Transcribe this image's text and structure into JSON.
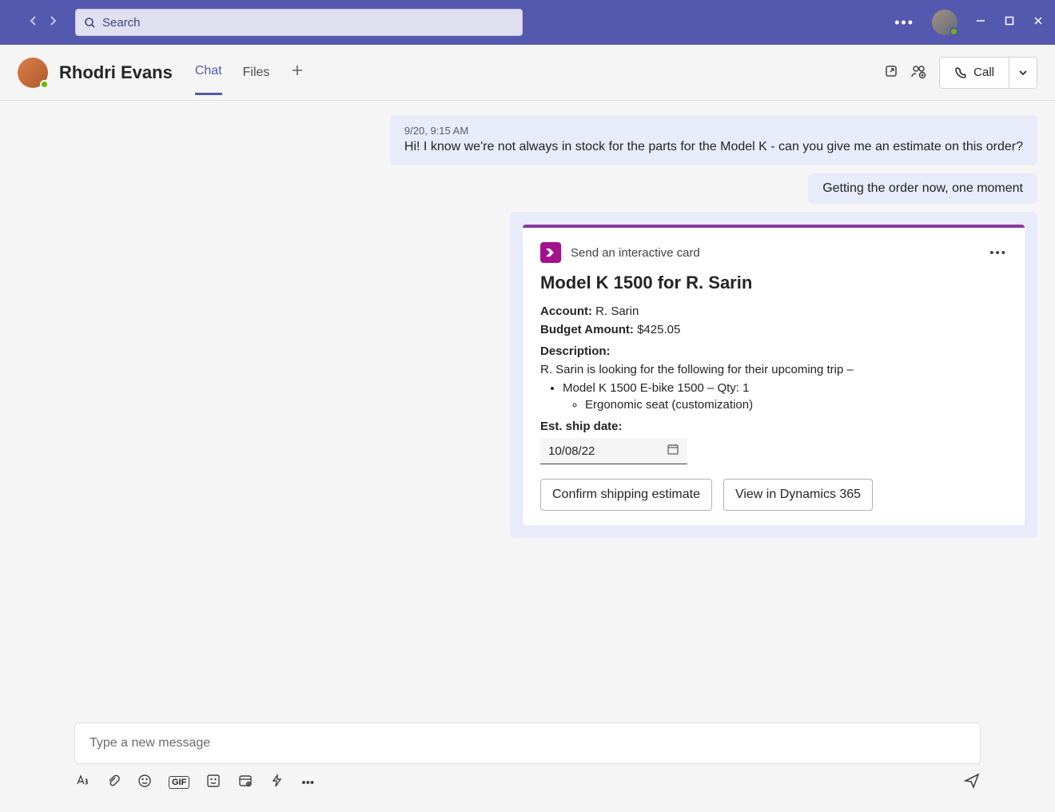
{
  "titlebar": {
    "search_placeholder": "Search"
  },
  "chatheader": {
    "name": "Rhodri Evans",
    "tabs": {
      "chat": "Chat",
      "files": "Files"
    },
    "call": "Call"
  },
  "messages": {
    "incoming": {
      "ts": "9/20, 9:15 AM",
      "text": "Hi! I know we're not always in stock for the parts for the Model K - can you give me an estimate on this order?"
    },
    "outgoing": {
      "text": "Getting the order now, one moment"
    }
  },
  "card": {
    "app_label": "Send an interactive card",
    "title": "Model K 1500 for R. Sarin",
    "account_label": "Account:",
    "account_value": "R. Sarin",
    "budget_label": "Budget Amount:",
    "budget_value": "$425.05",
    "description_label": "Description:",
    "description_text": "R. Sarin is looking for the following for their upcoming trip –",
    "item1": "Model K 1500 E-bike 1500 – Qty: 1",
    "item1_sub": "Ergonomic seat (customization)",
    "ship_label": "Est. ship date:",
    "ship_value": "10/08/22",
    "btn_confirm": "Confirm shipping estimate",
    "btn_view": "View in Dynamics 365"
  },
  "composer": {
    "placeholder": "Type a new message",
    "gif": "GIF"
  }
}
